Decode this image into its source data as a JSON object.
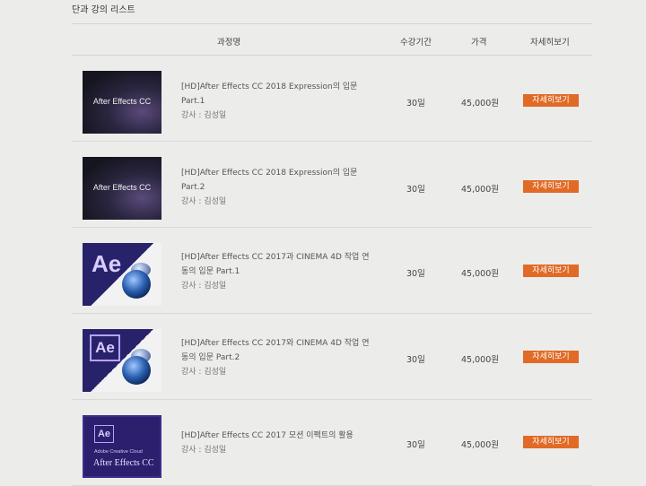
{
  "section_title": "단과 강의 리스트",
  "columns": {
    "course": "과정명",
    "period": "수강기간",
    "price": "가격",
    "detail": "자세히보기"
  },
  "courses": [
    {
      "title_line1": "[HD]After Effects CC 2018 Expression의 입문",
      "title_line2": "Part.1",
      "lecturer": "강사 : 김성일",
      "period": "30일",
      "price": "45,000원",
      "button": "자세히보기",
      "thumb_text": "After Effects CC"
    },
    {
      "title_line1": "[HD]After Effects CC 2018 Expression의 입문",
      "title_line2": "Part.2",
      "lecturer": "강사 : 김성일",
      "period": "30일",
      "price": "45,000원",
      "button": "자세히보기",
      "thumb_text": "After Effects CC"
    },
    {
      "title_line1": "[HD]After Effects CC 2017과 CINEMA 4D 작업 연",
      "title_line2": "동의 입문 Part.1",
      "lecturer": "강사 : 김성일",
      "period": "30일",
      "price": "45,000원",
      "button": "자세히보기",
      "thumb_text": "Ae"
    },
    {
      "title_line1": "[HD]After Effects CC 2017와 CINEMA 4D 작업 연",
      "title_line2": "동의 입문 Part.2",
      "lecturer": "강사 : 김성일",
      "period": "30일",
      "price": "45,000원",
      "button": "자세히보기",
      "thumb_text": "Ae"
    },
    {
      "title_line1": "[HD]After Effects CC 2017 모션 이펙트의 활용",
      "title_line2": "",
      "lecturer": "강사 : 김성일",
      "period": "30일",
      "price": "45,000원",
      "button": "자세히보기",
      "thumb_text": "Ae",
      "thumb_sub": "Adobe Creative Cloud",
      "thumb_name": "After Effects CC"
    }
  ],
  "colors": {
    "accent_button": "#e16a26",
    "background": "#ececea"
  }
}
